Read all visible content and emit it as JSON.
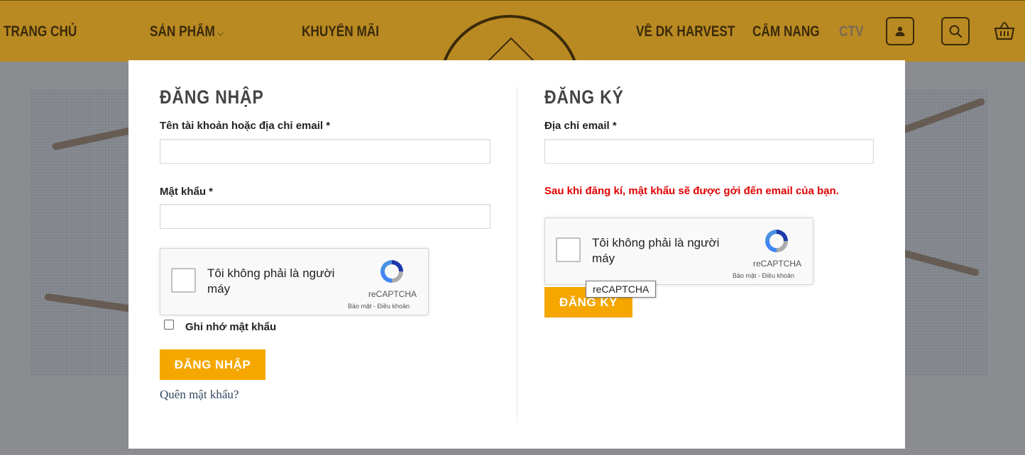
{
  "nav": {
    "items": [
      {
        "label": "TRANG CHỦ"
      },
      {
        "label": "SẢN PHẨM"
      },
      {
        "label": "KHUYẾN MÃI"
      },
      {
        "label": "VỀ DK HARVEST"
      },
      {
        "label": "CẨM NANG"
      },
      {
        "label": "CTV"
      }
    ],
    "icons": [
      "user-icon",
      "search-icon",
      "basket-icon"
    ],
    "colors": {
      "bar": "#b98a22",
      "text": "#3b2a0a"
    }
  },
  "login": {
    "heading": "ĐĂNG NHẬP",
    "username_label": "Tên tài khoản hoặc địa chỉ email *",
    "username_value": "",
    "password_label": "Mật khẩu *",
    "password_value": "",
    "remember_label": "Ghi nhớ mật khẩu",
    "remember_checked": false,
    "submit_label": "ĐĂNG NHẬP",
    "forgot_label": "Quên mật khẩu?"
  },
  "register": {
    "heading": "ĐĂNG KÝ",
    "email_label": "Địa chỉ email *",
    "email_value": "",
    "notice": "Sau khi đăng kí, mật khẩu sẽ được gởi đến email của bạn.",
    "submit_label": "ĐĂNG KÝ"
  },
  "recaptcha": {
    "text": "Tôi không phải là người máy",
    "brand": "reCAPTCHA",
    "privacy": "Bảo mật",
    "terms": "Điều khoản",
    "tooltip": "reCAPTCHA"
  },
  "colors": {
    "accent": "#f5a700",
    "error": "#e00000",
    "link": "#334862"
  }
}
